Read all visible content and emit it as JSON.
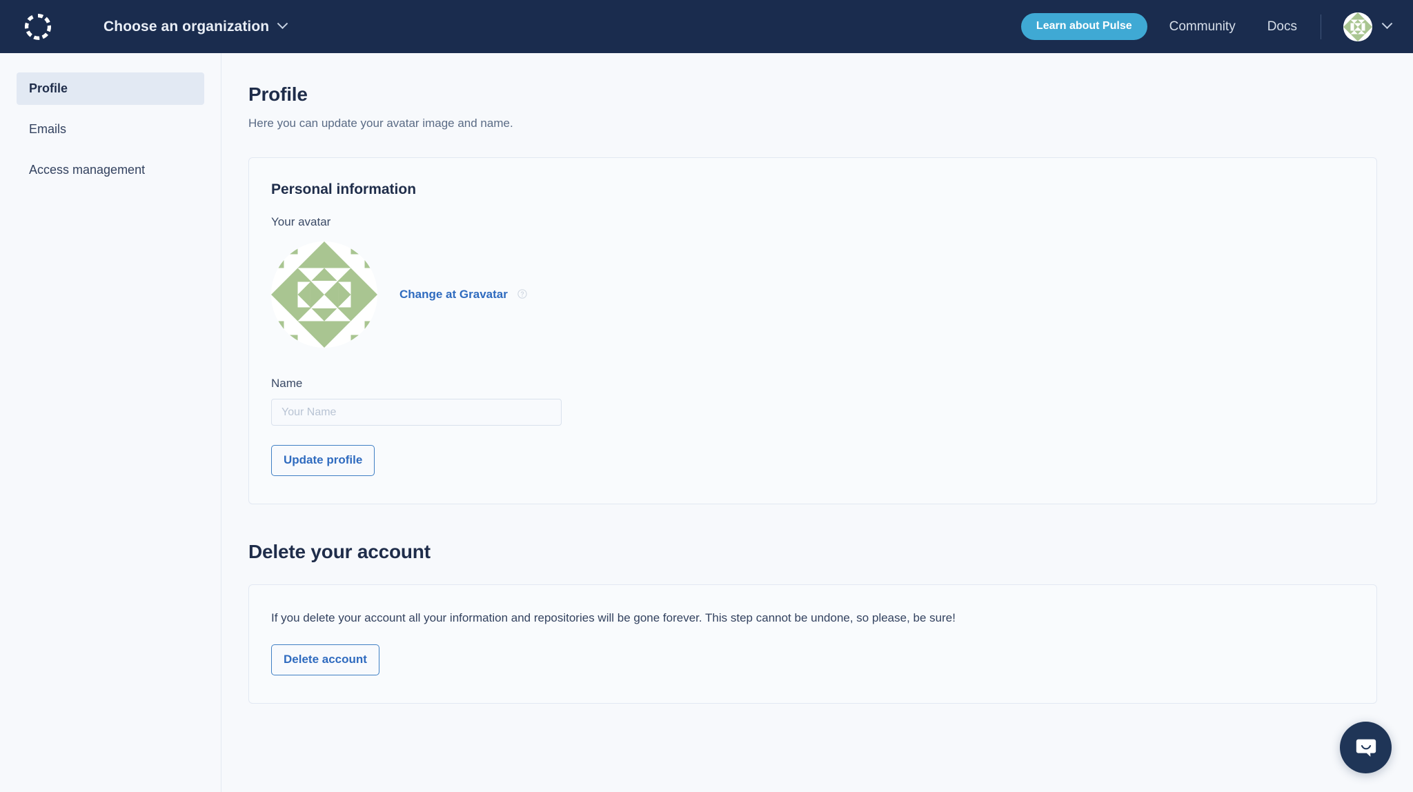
{
  "topbar": {
    "logo_icon": "segmented-circle-logo",
    "org_selector_label": "Choose an organization",
    "org_chevron_icon": "chevron-down-icon",
    "pulse_button_label": "Learn about Pulse",
    "nav_links": [
      {
        "label": "Community"
      },
      {
        "label": "Docs"
      }
    ],
    "user_avatar_icon": "user-avatar-identicon",
    "user_chevron_icon": "chevron-down-icon",
    "colors": {
      "background": "#1a2c4e",
      "pulse_button": "#3fa9d4",
      "link_text": "#d7dfea"
    }
  },
  "sidebar": {
    "items": [
      {
        "label": "Profile",
        "active": true
      },
      {
        "label": "Emails",
        "active": false
      },
      {
        "label": "Access management",
        "active": false
      }
    ],
    "active_background": "#e2e9f3"
  },
  "main": {
    "page_title": "Profile",
    "page_subtitle": "Here you can update your avatar image and name.",
    "personal_information": {
      "card_title": "Personal information",
      "avatar_label": "Your avatar",
      "avatar_icon": "user-avatar-identicon",
      "avatar_color": "#a9c591",
      "gravatar_link_label": "Change at Gravatar",
      "gravatar_help_icon": "help-circle-icon",
      "name_label": "Name",
      "name_value": "",
      "name_placeholder": "Your Name",
      "update_button_label": "Update profile"
    },
    "delete_account": {
      "section_title": "Delete your account",
      "warning_text": "If you delete your account all your information and repositories will be gone forever. This step cannot be undone, so please, be sure!",
      "delete_button_label": "Delete account"
    }
  },
  "chat": {
    "launcher_icon": "chat-bubble-icon",
    "launcher_color": "#1f3557"
  }
}
